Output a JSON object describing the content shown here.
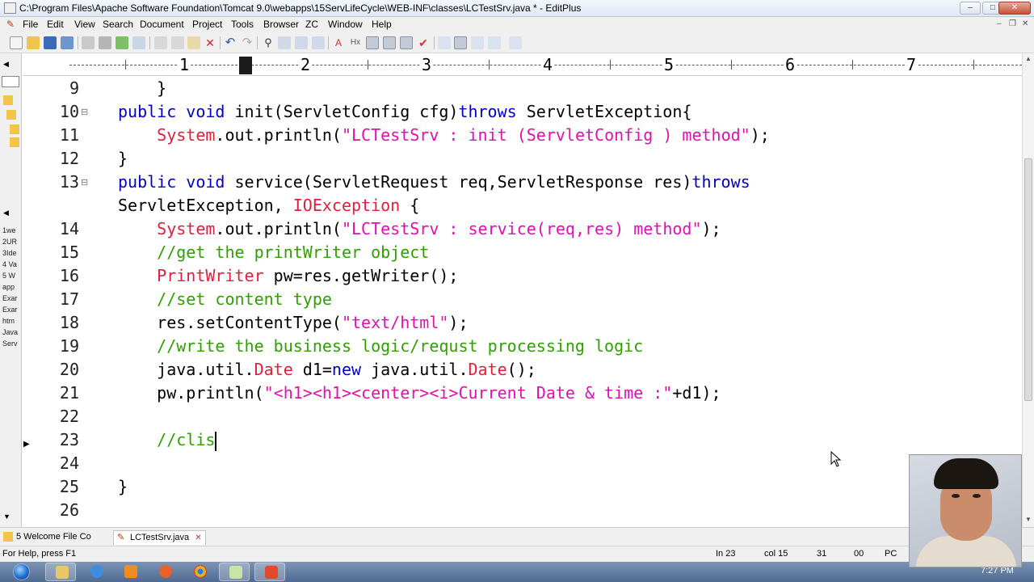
{
  "window": {
    "title": "C:\\Program Files\\Apache Software Foundation\\Tomcat 9.0\\webapps\\15ServLifeCycle\\WEB-INF\\classes\\LCTestSrv.java * - EditPlus"
  },
  "menu": [
    "File",
    "Edit",
    "View",
    "Search",
    "Document",
    "Project",
    "Tools",
    "Browser",
    "ZC",
    "Window",
    "Help"
  ],
  "ruler": {
    "numbers": [
      "1",
      "2",
      "3",
      "4",
      "5",
      "6",
      "7"
    ]
  },
  "left_panel_items": [
    "1we",
    "2UR",
    "3Ide",
    "4 Va",
    "5 W",
    "app",
    "Exar",
    "Exar",
    "htm",
    "Java",
    "Serv"
  ],
  "editor": {
    "lines": [
      {
        "num": "9",
        "fold": "",
        "segments": [
          {
            "t": "    }",
            "c": "plain"
          }
        ]
      },
      {
        "num": "10",
        "fold": "⊟",
        "segments": [
          {
            "t": "public void",
            "c": "kw"
          },
          {
            "t": " init(ServletConfig cfg)",
            "c": "plain"
          },
          {
            "t": "throws",
            "c": "kw"
          },
          {
            "t": " ServletException{",
            "c": "plain"
          }
        ]
      },
      {
        "num": "11",
        "fold": "",
        "segments": [
          {
            "t": "    ",
            "c": "plain"
          },
          {
            "t": "System",
            "c": "cls"
          },
          {
            "t": ".out.println(",
            "c": "plain"
          },
          {
            "t": "\"LCTestSrv : init (ServletConfig ) method\"",
            "c": "str"
          },
          {
            "t": ");",
            "c": "plain"
          }
        ]
      },
      {
        "num": "12",
        "fold": "",
        "segments": [
          {
            "t": "}",
            "c": "plain"
          }
        ]
      },
      {
        "num": "13",
        "fold": "⊟",
        "segments": [
          {
            "t": "public void",
            "c": "kw"
          },
          {
            "t": " service(ServletRequest req,ServletResponse res)",
            "c": "plain"
          },
          {
            "t": "throws",
            "c": "kw"
          }
        ]
      },
      {
        "num": "",
        "fold": "",
        "segments": [
          {
            "t": "ServletException, ",
            "c": "plain"
          },
          {
            "t": "IOException",
            "c": "cls"
          },
          {
            "t": " {",
            "c": "plain"
          }
        ]
      },
      {
        "num": "14",
        "fold": "",
        "segments": [
          {
            "t": "    ",
            "c": "plain"
          },
          {
            "t": "System",
            "c": "cls"
          },
          {
            "t": ".out.println(",
            "c": "plain"
          },
          {
            "t": "\"LCTestSrv : service(req,res) method\"",
            "c": "str"
          },
          {
            "t": ");",
            "c": "plain"
          }
        ]
      },
      {
        "num": "15",
        "fold": "",
        "segments": [
          {
            "t": "    ",
            "c": "plain"
          },
          {
            "t": "//get the printWriter object",
            "c": "cmt"
          }
        ]
      },
      {
        "num": "16",
        "fold": "",
        "segments": [
          {
            "t": "    ",
            "c": "plain"
          },
          {
            "t": "PrintWriter",
            "c": "cls"
          },
          {
            "t": " pw=res.getWriter();",
            "c": "plain"
          }
        ]
      },
      {
        "num": "17",
        "fold": "",
        "segments": [
          {
            "t": "    ",
            "c": "plain"
          },
          {
            "t": "//set content type",
            "c": "cmt"
          }
        ]
      },
      {
        "num": "18",
        "fold": "",
        "segments": [
          {
            "t": "    res.setContentType(",
            "c": "plain"
          },
          {
            "t": "\"text/html\"",
            "c": "str"
          },
          {
            "t": ");",
            "c": "plain"
          }
        ]
      },
      {
        "num": "19",
        "fold": "",
        "segments": [
          {
            "t": "    ",
            "c": "plain"
          },
          {
            "t": "//write the business logic/requst processing logic",
            "c": "cmt"
          }
        ]
      },
      {
        "num": "20",
        "fold": "",
        "segments": [
          {
            "t": "    java.util.",
            "c": "plain"
          },
          {
            "t": "Date",
            "c": "cls"
          },
          {
            "t": " d1=",
            "c": "plain"
          },
          {
            "t": "new",
            "c": "kw"
          },
          {
            "t": " java.util.",
            "c": "plain"
          },
          {
            "t": "Date",
            "c": "cls"
          },
          {
            "t": "();",
            "c": "plain"
          }
        ]
      },
      {
        "num": "21",
        "fold": "",
        "segments": [
          {
            "t": "    pw.println(",
            "c": "plain"
          },
          {
            "t": "\"<h1><h1><center><i>Current Date & time :\"",
            "c": "str"
          },
          {
            "t": "+d1);",
            "c": "plain"
          }
        ]
      },
      {
        "num": "22",
        "fold": "",
        "segments": [
          {
            "t": "",
            "c": "plain"
          }
        ]
      },
      {
        "num": "23",
        "fold": "",
        "segments": [
          {
            "t": "    ",
            "c": "plain"
          },
          {
            "t": "//clis",
            "c": "cmt"
          }
        ]
      },
      {
        "num": "24",
        "fold": "",
        "segments": [
          {
            "t": "",
            "c": "plain"
          }
        ]
      },
      {
        "num": "25",
        "fold": "",
        "segments": [
          {
            "t": "}",
            "c": "plain"
          }
        ]
      },
      {
        "num": "26",
        "fold": "",
        "segments": [
          {
            "t": "",
            "c": "plain"
          }
        ]
      }
    ]
  },
  "tabs": [
    {
      "label": "5 Welcome File Co",
      "active": false
    },
    {
      "label": "LCTestSrv.java",
      "active": true
    }
  ],
  "status": {
    "help": "For Help, press F1",
    "line": "In 23",
    "col": "col 15",
    "num1": "31",
    "num2": "00",
    "mode": "PC"
  },
  "taskbar": {
    "clock": "7:27 PM"
  },
  "colors": {
    "keyword": "#0000c8",
    "class": "#e0203a",
    "string": "#e010b0",
    "comment": "#2ea000"
  }
}
